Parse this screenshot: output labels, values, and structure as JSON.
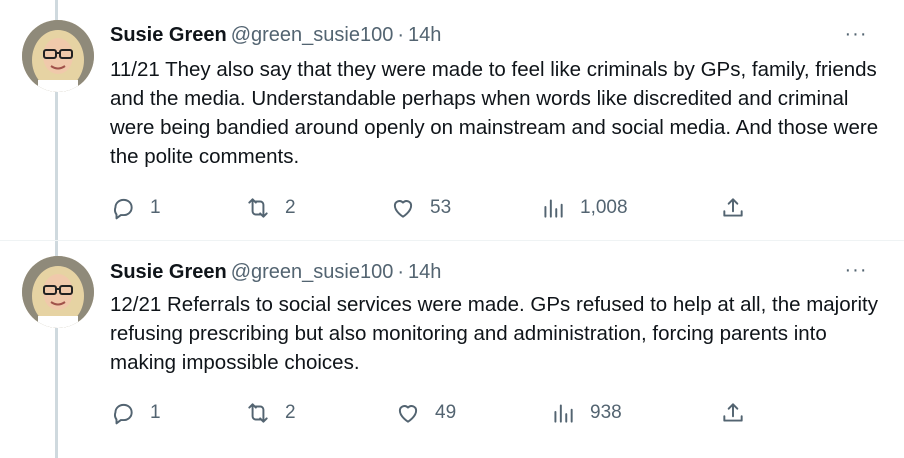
{
  "tweets": [
    {
      "author_name": "Susie Green",
      "handle": "@green_susie100",
      "separator": "·",
      "time": "14h",
      "more_label": "···",
      "text": "11/21 They also say that they were made to feel like criminals by GPs, family, friends and the media. Understandable perhaps when words like discredited and criminal were being bandied around openly on mainstream and social media. And those were the polite comments.",
      "replies": "1",
      "retweets": "2",
      "likes": "53",
      "views": "1,008",
      "icons": [
        "reply-icon",
        "retweet-icon",
        "like-icon",
        "views-icon",
        "share-icon"
      ]
    },
    {
      "author_name": "Susie Green",
      "handle": "@green_susie100",
      "separator": "·",
      "time": "14h",
      "more_label": "···",
      "text": "12/21 Referrals to social services were made. GPs refused to help at all, the majority refusing prescribing but also monitoring and administration, forcing parents into making impossible choices.",
      "replies": "1",
      "retweets": "2",
      "likes": "49",
      "views": "938",
      "icons": [
        "reply-icon",
        "retweet-icon",
        "like-icon",
        "views-icon",
        "share-icon"
      ]
    }
  ],
  "colors": {
    "text": "#0f1419",
    "secondary": "#536471",
    "thread_line": "#cfd9de"
  }
}
